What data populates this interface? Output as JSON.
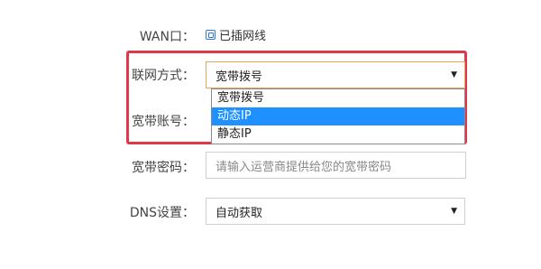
{
  "wan": {
    "label": "WAN口：",
    "status_text": "已插网线"
  },
  "connection_type": {
    "label": "联网方式：",
    "selected": "宽带拨号",
    "options": [
      "宽带拨号",
      "动态IP",
      "静态IP"
    ],
    "highlighted_option": "动态IP"
  },
  "account": {
    "label": "宽带账号："
  },
  "password": {
    "label": "宽带密码：",
    "placeholder": "请输入运营商提供给您的宽带密码"
  },
  "dns": {
    "label": "DNS设置：",
    "selected": "自动获取"
  },
  "colors": {
    "highlight_border": "#e0384a",
    "option_active_bg": "#1e90ff",
    "select_focus_border": "#e8a25a",
    "icon_blue": "#2a7ad2"
  },
  "icons": {
    "wan_status": "ethernet-port-icon",
    "select_caret": "caret-down-icon"
  }
}
